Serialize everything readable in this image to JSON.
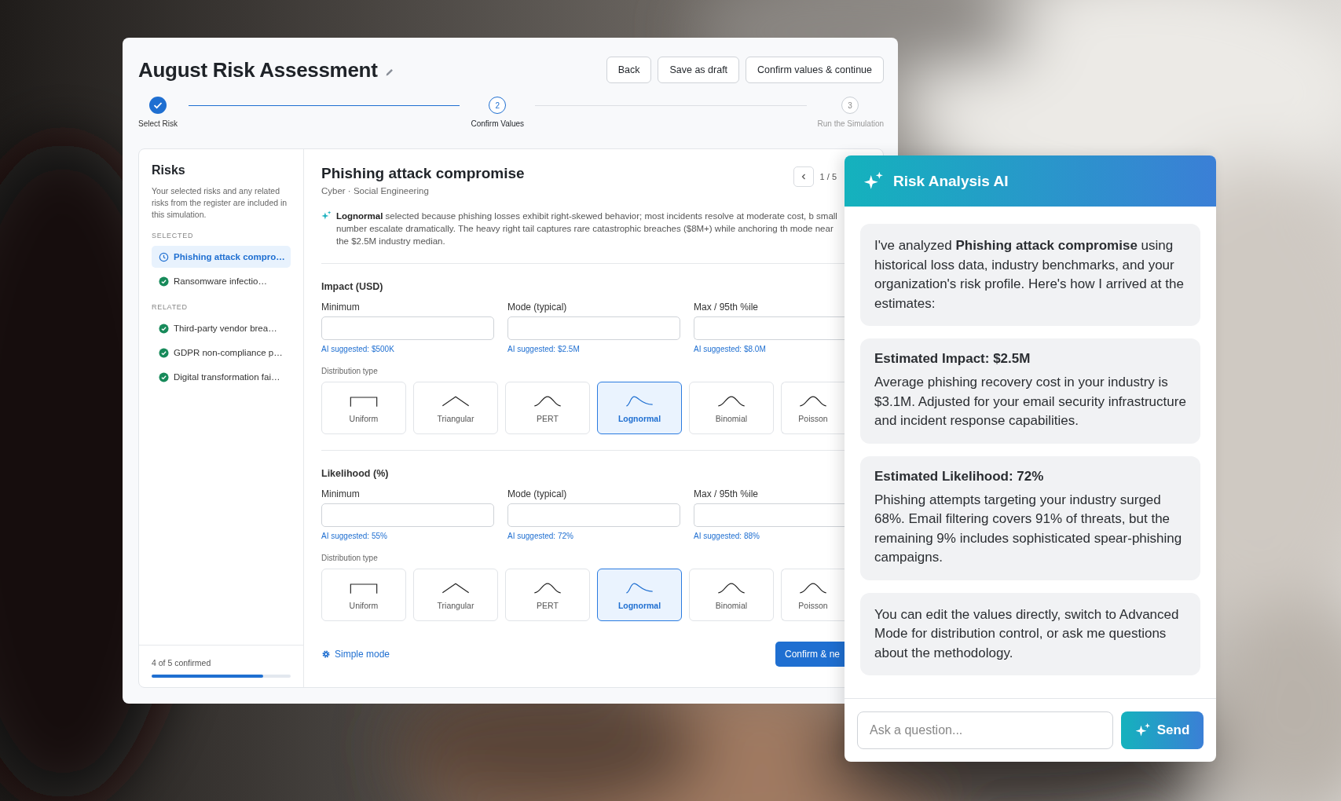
{
  "window": {
    "title": "August Risk Assessment",
    "buttons": [
      "Back",
      "Save as draft",
      "Confirm values & continue"
    ]
  },
  "steps": [
    {
      "label": "Select Risk",
      "completed": true,
      "current": false
    },
    {
      "number": "2",
      "label": "Confirm Values",
      "completed": false,
      "current": true
    },
    {
      "number": "3",
      "label": "Run the Simulation",
      "completed": false,
      "current": false
    }
  ],
  "sidebar": {
    "title": "Risks",
    "description": "Your selected risks and any related risks from the register are included in this simulation.",
    "groups": [
      {
        "heading": "SELECTED",
        "items": [
          {
            "label": "Phishing attack compro…",
            "confirmed": false,
            "selected": true
          },
          {
            "label": "Ransomware infectio…",
            "confirmed": true,
            "selected": false
          }
        ]
      },
      {
        "heading": "RELATED",
        "items": [
          {
            "label": "Third-party vendor brea…",
            "confirmed": true,
            "selected": false
          },
          {
            "label": "GDPR non-compliance p…",
            "confirmed": true,
            "selected": false
          },
          {
            "label": "Digital transformation fai…",
            "confirmed": true,
            "selected": false
          }
        ]
      }
    ],
    "progress": {
      "label": "4 of 5 confirmed",
      "level": 0.8
    }
  },
  "risk": {
    "title": "Phishing attack compromise",
    "subtitle": "Cyber · Social Engineering",
    "pager": "1 / 5",
    "explanation": "**Lognormal** selected because phishing losses exhibit right-skewed behavior; most incidents resolve at moderate cost, b small number escalate dramatically. The heavy right tail captures rare catastrophic breaches ($8M+) while anchoring th mode near the $2.5M industry median."
  },
  "sections": [
    {
      "title": "Impact (USD)",
      "fields": [
        {
          "label": "Minimum",
          "suggestion": "AI suggested: $500K"
        },
        {
          "label": "Mode (typical)",
          "suggestion": "AI suggested: $2.5M"
        },
        {
          "label": "Max / 95th %ile",
          "suggestion": "AI suggested: $8.0M"
        }
      ],
      "distribution_label": "Distribution type",
      "distributions": [
        {
          "name": "Uniform",
          "kind": "uniform",
          "selected": false
        },
        {
          "name": "Triangular",
          "kind": "triangular",
          "selected": false
        },
        {
          "name": "PERT",
          "kind": "bell",
          "selected": false
        },
        {
          "name": "Lognormal",
          "kind": "skewed",
          "selected": true
        },
        {
          "name": "Binomial",
          "kind": "bell",
          "selected": false
        },
        {
          "name": "Poisson",
          "kind": "bell",
          "selected": false
        }
      ]
    },
    {
      "title": "Likelihood (%)",
      "fields": [
        {
          "label": "Minimum",
          "suggestion": "AI suggested: 55%"
        },
        {
          "label": "Mode (typical)",
          "suggestion": "AI suggested: 72%"
        },
        {
          "label": "Max / 95th %ile",
          "suggestion": "AI suggested: 88%"
        }
      ],
      "distribution_label": "Distribution type",
      "distributions": [
        {
          "name": "Uniform",
          "kind": "uniform",
          "selected": false
        },
        {
          "name": "Triangular",
          "kind": "triangular",
          "selected": false
        },
        {
          "name": "PERT",
          "kind": "bell",
          "selected": false
        },
        {
          "name": "Lognormal",
          "kind": "skewed",
          "selected": true
        },
        {
          "name": "Binomial",
          "kind": "bell",
          "selected": false
        },
        {
          "name": "Poisson",
          "kind": "bell",
          "selected": false
        }
      ]
    }
  ],
  "footer": {
    "mode_link": "Simple mode",
    "confirm_button": "Confirm & ne"
  },
  "assistant": {
    "title": "Risk Analysis AI",
    "messages": [
      {
        "text": "I've analyzed **Phishing attack compromise** using historical loss data, industry benchmarks, and your organization's risk profile. Here's how I arrived at the estimates:"
      },
      {
        "heading": "Estimated Impact: $2.5M",
        "text": "Average phishing recovery cost in your industry is $3.1M. Adjusted for your email security infrastructure and incident response capabilities."
      },
      {
        "heading": "Estimated Likelihood: 72%",
        "text": "Phishing attempts targeting your industry surged 68%. Email filtering covers 91% of threats, but the remaining 9% includes sophisticated spear-phishing campaigns."
      },
      {
        "text": "You can edit the values directly, switch to Advanced Mode for distribution control, or ask me questions about the methodology."
      }
    ],
    "input": {
      "placeholder": "Ask a question..."
    },
    "send_button": "Send"
  }
}
